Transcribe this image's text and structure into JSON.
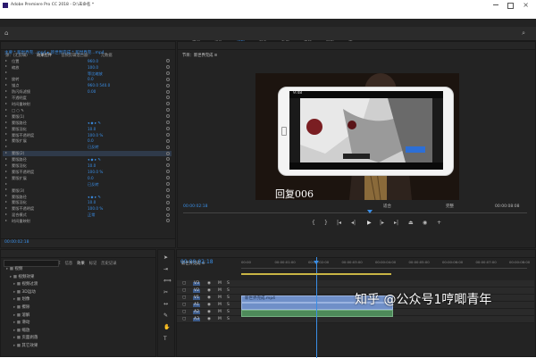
{
  "titlebar": {
    "title": "Adobe Premiere Pro CC 2018 - D:\\未命名 *"
  },
  "menubar": {
    "items": [
      "文件(F)",
      "编辑(E)",
      "剪辑(C)",
      "序列(S)",
      "标记(M)",
      "图形(G)",
      "窗口(W)",
      "帮助(H)"
    ]
  },
  "workspace_tabs": [
    "学习",
    "组件",
    "编辑",
    "颜色",
    "效果",
    "音频",
    "图形",
    "库"
  ],
  "effect_controls": {
    "tabs": [
      "源：(无剪辑)",
      "效果控件",
      "音频剪辑混合器：",
      "元数据"
    ],
    "clip_header": "主要 * 新世界完...mp4 ▸ 新世界完成 * 新世界完...mp4",
    "rows": [
      {
        "label": "位置",
        "value": "960.0"
      },
      {
        "label": "缩放",
        "value": "100.0"
      },
      {
        "label": "",
        "value": "等比缩放"
      },
      {
        "label": "旋转",
        "value": "0.0"
      },
      {
        "label": "锚点",
        "value": "960.0   540.0"
      },
      {
        "label": "防闪烁滤镜",
        "value": "0.00"
      },
      {
        "label": "不透明度",
        "value": ""
      },
      {
        "label": "时间重映射",
        "value": ""
      },
      {
        "label": "□ ○ ✎",
        "value": ""
      },
      {
        "label": "蒙版(1)",
        "value": ""
      },
      {
        "label": "蒙版路径",
        "value": "◂ ◆ ▸ ✎"
      },
      {
        "label": "蒙版羽化",
        "value": "10.0"
      },
      {
        "label": "蒙版不透明度",
        "value": "100.0 %"
      },
      {
        "label": "蒙版扩展",
        "value": "0.0"
      },
      {
        "label": "",
        "value": "已反转"
      },
      {
        "label": "蒙版(2)",
        "value": ""
      },
      {
        "label": "蒙版路径",
        "value": "◂ ◆ ▸ ✎"
      },
      {
        "label": "蒙版羽化",
        "value": "10.0"
      },
      {
        "label": "蒙版不透明度",
        "value": "100.0 %"
      },
      {
        "label": "蒙版扩展",
        "value": "0.0"
      },
      {
        "label": "",
        "value": "已反转"
      },
      {
        "label": "蒙版(3)",
        "value": ""
      },
      {
        "label": "蒙版路径",
        "value": "◂ ◆ ▸ ✎"
      },
      {
        "label": "蒙版羽化",
        "value": "10.0"
      },
      {
        "label": "蒙版不透明度",
        "value": "100.0 %"
      },
      {
        "label": "混合模式",
        "value": "正常"
      },
      {
        "label": "时间重映射",
        "value": ""
      }
    ],
    "timecode": "00:00:02:18"
  },
  "program_monitor": {
    "tab": "节目：新世界完成 ≡",
    "timecode_left": "00:00:02:18",
    "zoom": "适合",
    "quality": "完整",
    "timecode_right": "00:00:08:08",
    "subtitle": "回复006",
    "phone_overlay_label": "9:48"
  },
  "project_panel": {
    "tabs": [
      "项目：未命名",
      "媒体浏览器",
      "库",
      "信息",
      "效果",
      "标记",
      "历史记录"
    ],
    "items": [
      "视频",
      "视频效果",
      "视频过渡",
      "3D运动",
      "划像",
      "擦除",
      "溶解",
      "滑动",
      "缩放",
      "页面剥落",
      "其它效果"
    ]
  },
  "timeline": {
    "tab": "新世界完成 ≡",
    "timecode": "00:00:02:18",
    "ticks": [
      "00:00",
      "00:00:01:00",
      "00:00:02:00",
      "00:00:03:00",
      "00:00:04:00",
      "00:00:05:00",
      "00:00:06:00",
      "00:00:07:00",
      "00:00:08:00"
    ],
    "tracks": [
      "V3",
      "V2",
      "V1",
      "A1",
      "A2",
      "A3"
    ],
    "clip_label": "新世界完成.mp4"
  },
  "watermark": {
    "text": "知乎 @公众号1哼唧青年"
  },
  "colors": {
    "accent": "#3a8ee6",
    "panel_bg": "#232323",
    "clip_blue": "#6f8fc8",
    "clip_green": "#4e8a5a",
    "playhead": "#3a8ee6"
  }
}
